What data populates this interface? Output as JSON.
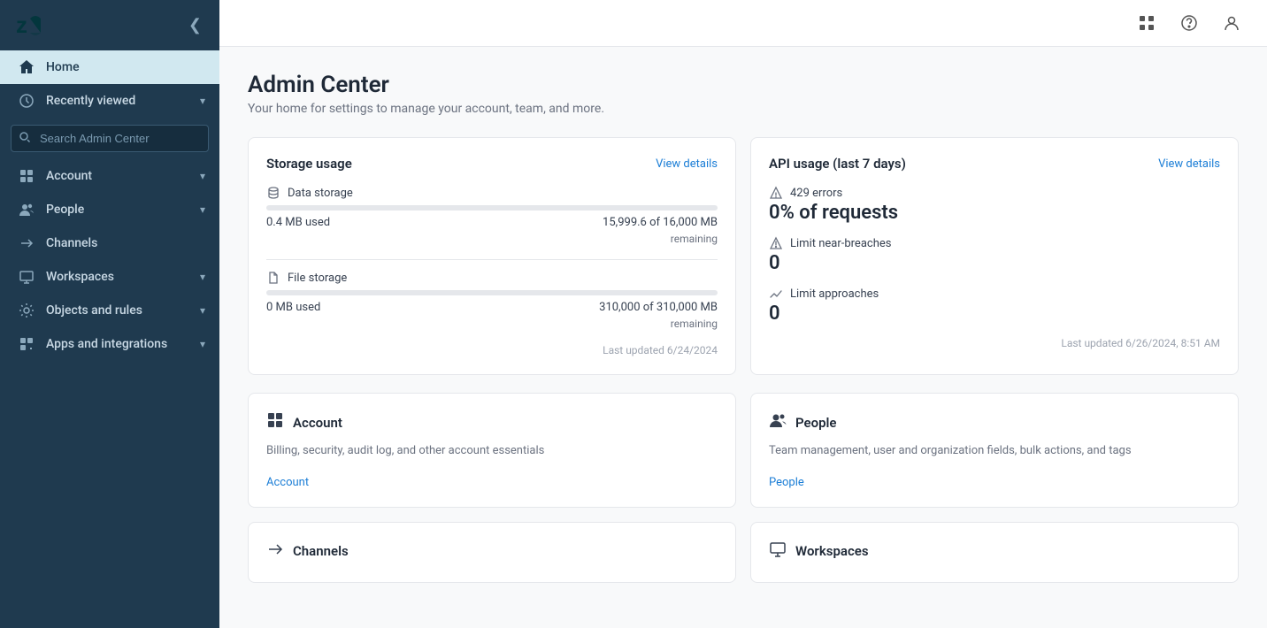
{
  "sidebar": {
    "logo_alt": "Zendesk",
    "collapse_icon": "❮",
    "recently_viewed_label": "Recently viewed",
    "search_placeholder": "Search Admin Center",
    "nav_items": [
      {
        "id": "home",
        "label": "Home",
        "icon": "🏠",
        "active": true,
        "chevron": ""
      },
      {
        "id": "recently-viewed",
        "label": "Recently viewed",
        "icon": "🕐",
        "active": false,
        "chevron": "▾"
      },
      {
        "id": "account",
        "label": "Account",
        "icon": "⊞",
        "active": false,
        "chevron": "▾"
      },
      {
        "id": "people",
        "label": "People",
        "icon": "👥",
        "active": false,
        "chevron": "▾"
      },
      {
        "id": "channels",
        "label": "Channels",
        "icon": "↔",
        "active": false,
        "chevron": ""
      },
      {
        "id": "workspaces",
        "label": "Workspaces",
        "icon": "🖥",
        "active": false,
        "chevron": "▾"
      },
      {
        "id": "objects-and-rules",
        "label": "Objects and rules",
        "icon": "⚙",
        "active": false,
        "chevron": "▾"
      },
      {
        "id": "apps-and-integrations",
        "label": "Apps and integrations",
        "icon": "⊕",
        "active": false,
        "chevron": "▾"
      }
    ]
  },
  "topbar": {
    "grid_icon": "⊞",
    "help_icon": "?",
    "user_icon": "👤"
  },
  "page": {
    "title": "Admin Center",
    "subtitle": "Your home for settings to manage your account, team, and more."
  },
  "storage_card": {
    "title": "Storage usage",
    "view_details_label": "View details",
    "data_storage": {
      "label": "Data storage",
      "used_label": "0.4 MB used",
      "remaining_label": "15,999.6 of 16,000 MB",
      "remaining_suffix": "remaining",
      "fill_percent": 0.003
    },
    "file_storage": {
      "label": "File storage",
      "used_label": "0 MB used",
      "remaining_label": "310,000 of 310,000 MB",
      "remaining_suffix": "remaining",
      "fill_percent": 0
    },
    "last_updated": "Last updated 6/24/2024"
  },
  "api_card": {
    "title": "API usage (last 7 days)",
    "view_details_label": "View details",
    "errors_label": "429 errors",
    "requests_value": "0% of requests",
    "limit_near_breaches_label": "Limit near-breaches",
    "limit_near_breaches_value": "0",
    "limit_approaches_label": "Limit approaches",
    "limit_approaches_value": "0",
    "last_updated": "Last updated 6/26/2024, 8:51 AM"
  },
  "info_cards": [
    {
      "id": "account",
      "icon": "⊞",
      "title": "Account",
      "description": "Billing, security, audit log, and other account essentials",
      "link_label": "Account"
    },
    {
      "id": "people",
      "icon": "👥",
      "title": "People",
      "description": "Team management, user and organization fields, bulk actions, and tags",
      "link_label": "People"
    },
    {
      "id": "channels",
      "icon": "↔",
      "title": "Channels",
      "description": "",
      "link_label": ""
    },
    {
      "id": "workspaces",
      "icon": "🖥",
      "title": "Workspaces",
      "description": "",
      "link_label": ""
    }
  ]
}
